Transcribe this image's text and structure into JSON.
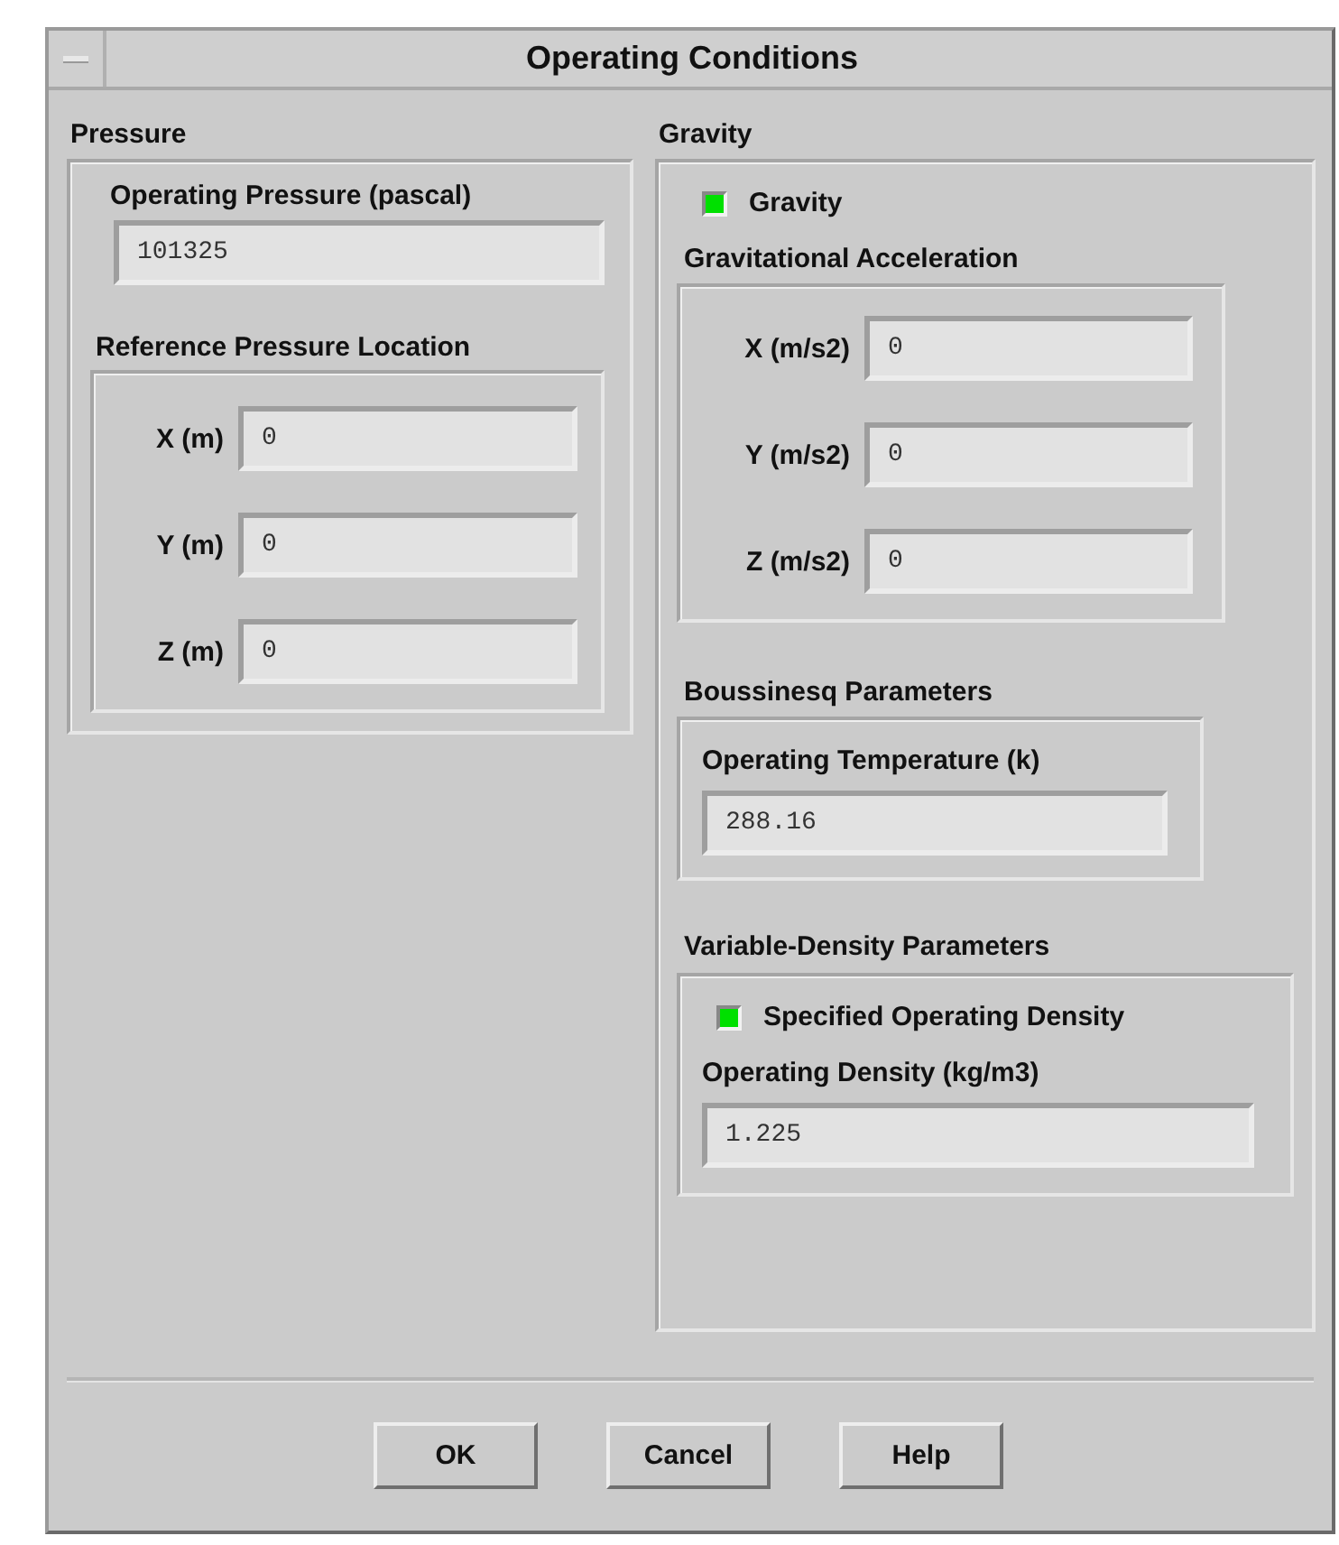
{
  "window": {
    "title": "Operating Conditions"
  },
  "pressure": {
    "heading": "Pressure",
    "operating_pressure": {
      "label": "Operating Pressure (pascal)",
      "value": "101325"
    },
    "reference_location": {
      "heading": "Reference Pressure Location",
      "fields": [
        {
          "label": "X (m)",
          "value": "0"
        },
        {
          "label": "Y (m)",
          "value": "0"
        },
        {
          "label": "Z (m)",
          "value": "0"
        }
      ]
    }
  },
  "gravity": {
    "heading": "Gravity",
    "toggle": {
      "label": "Gravity",
      "checked": true
    },
    "acceleration": {
      "heading": "Gravitational Acceleration",
      "fields": [
        {
          "label": "X (m/s2)",
          "value": "0"
        },
        {
          "label": "Y (m/s2)",
          "value": "0"
        },
        {
          "label": "Z (m/s2)",
          "value": "0"
        }
      ]
    },
    "boussinesq": {
      "heading": "Boussinesq Parameters",
      "temperature": {
        "label": "Operating Temperature (k)",
        "value": "288.16"
      }
    },
    "variable_density": {
      "heading": "Variable-Density Parameters",
      "toggle": {
        "label": "Specified Operating Density",
        "checked": true
      },
      "density": {
        "label": "Operating Density (kg/m3)",
        "value": "1.225"
      }
    }
  },
  "buttons": [
    "OK",
    "Cancel",
    "Help"
  ]
}
